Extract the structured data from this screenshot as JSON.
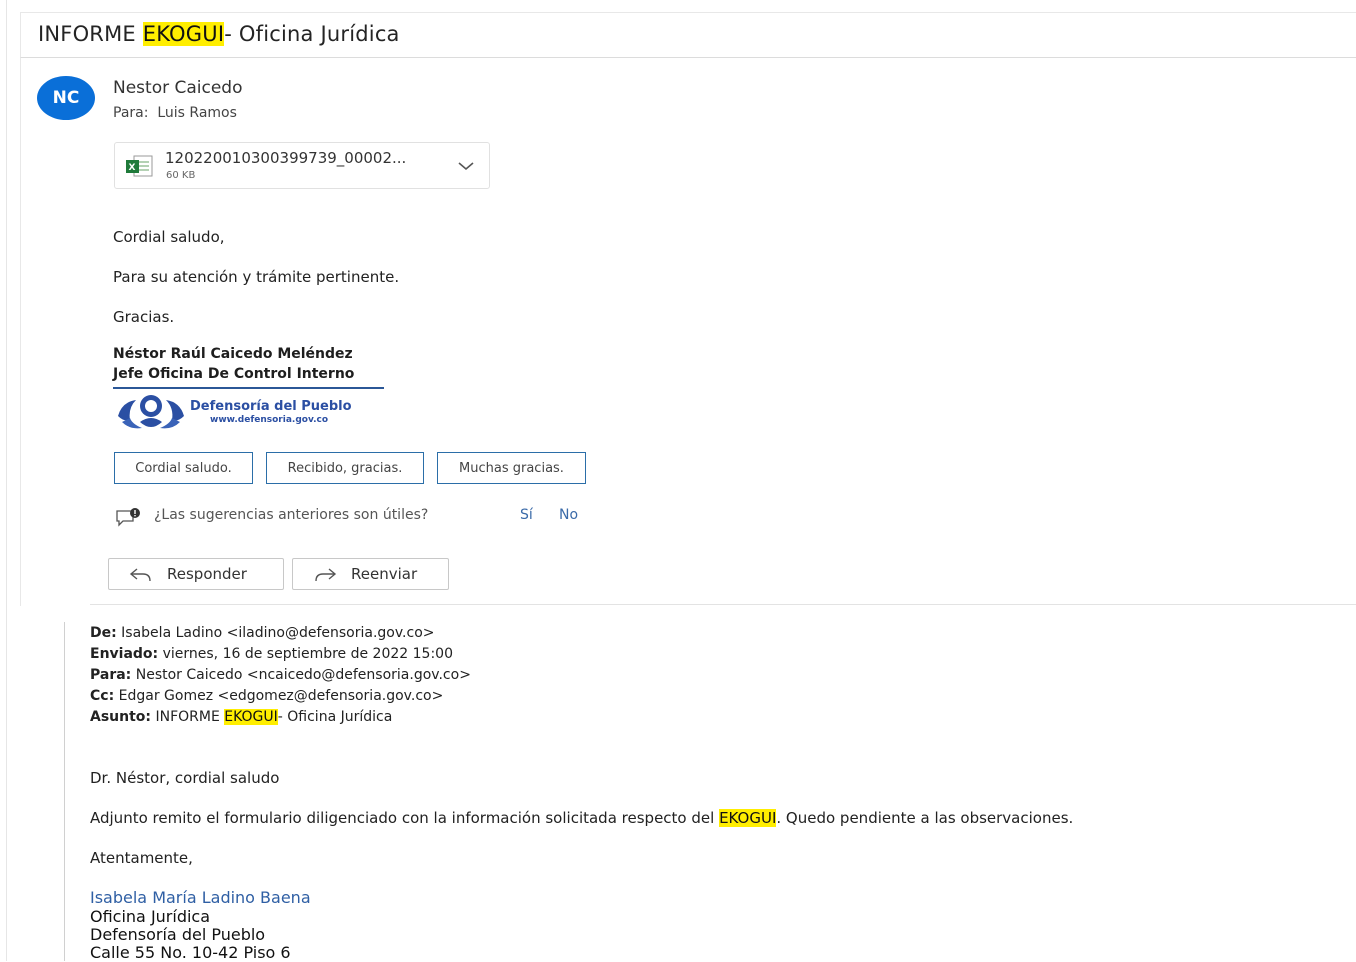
{
  "subject": {
    "prefix": "INFORME ",
    "highlight": "EKOGUI",
    "suffix": "- Oficina Jurídica"
  },
  "message": {
    "avatar_initials": "NC",
    "avatar_color": "#0a6fd8",
    "sender": "Nestor Caicedo",
    "to_label": "Para:",
    "to_value": "Luis Ramos",
    "attachment": {
      "name": "120220010300399739_00002...",
      "size": "60 KB",
      "icon": "excel-file-icon"
    },
    "body": [
      "Cordial saludo,",
      "Para su atención y trámite pertinente.",
      "Gracias."
    ],
    "signature": {
      "name": "Néstor Raúl Caicedo Meléndez",
      "title": "Jefe Oficina De Control Interno",
      "logo_title": "Defensoría del Pueblo",
      "logo_url": "www.defensoria.gov.co"
    }
  },
  "suggested_replies": [
    "Cordial saludo.",
    "Recibido, gracias.",
    "Muchas gracias."
  ],
  "feedback": {
    "question": "¿Las sugerencias anteriores son útiles?",
    "yes": "Sí",
    "no": "No"
  },
  "actions": {
    "reply": "Responder",
    "forward": "Reenviar"
  },
  "quoted": {
    "from_label": "De:",
    "from_value": "Isabela Ladino <iladino@defensoria.gov.co>",
    "sent_label": "Enviado:",
    "sent_value": "viernes, 16 de septiembre de 2022 15:00",
    "to_label": "Para:",
    "to_value": "Nestor Caicedo <ncaicedo@defensoria.gov.co>",
    "cc_label": "Cc:",
    "cc_value": "Edgar Gomez <edgomez@defensoria.gov.co>",
    "subject_label": "Asunto:",
    "subject_prefix": "INFORME ",
    "subject_highlight": "EKOGUI",
    "subject_suffix": "- Oficina Jurídica",
    "greeting": "Dr. Néstor, cordial saludo",
    "body_prefix": "Adjunto remito el formulario diligenciado con la información solicitada respecto del ",
    "body_highlight": "EKOGUI",
    "body_suffix": ". Quedo pendiente a las observaciones.",
    "closing": "Atentamente,",
    "sig_name": "Isabela María Ladino Baena",
    "sig_lines": [
      "Oficina Jurídica",
      "Defensoría del Pueblo",
      "Calle 55 No. 10-42 Piso 6"
    ]
  },
  "highlight_color": "#ffee00"
}
